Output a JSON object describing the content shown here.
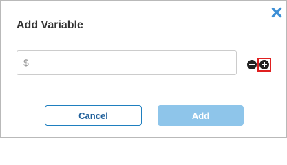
{
  "dialog": {
    "title": "Add Variable",
    "close_icon": "close-x-icon"
  },
  "variable_input": {
    "value": "",
    "placeholder": "$"
  },
  "row_actions": {
    "remove_icon": "minus-circle-icon",
    "add_icon": "plus-circle-icon"
  },
  "footer": {
    "cancel_label": "Cancel",
    "add_label": "Add",
    "add_enabled": false
  },
  "colors": {
    "accent": "#1f7fbf",
    "close_icon": "#3d8fd6",
    "add_disabled_bg": "#8ec5ea",
    "highlight_border": "#e02020"
  }
}
